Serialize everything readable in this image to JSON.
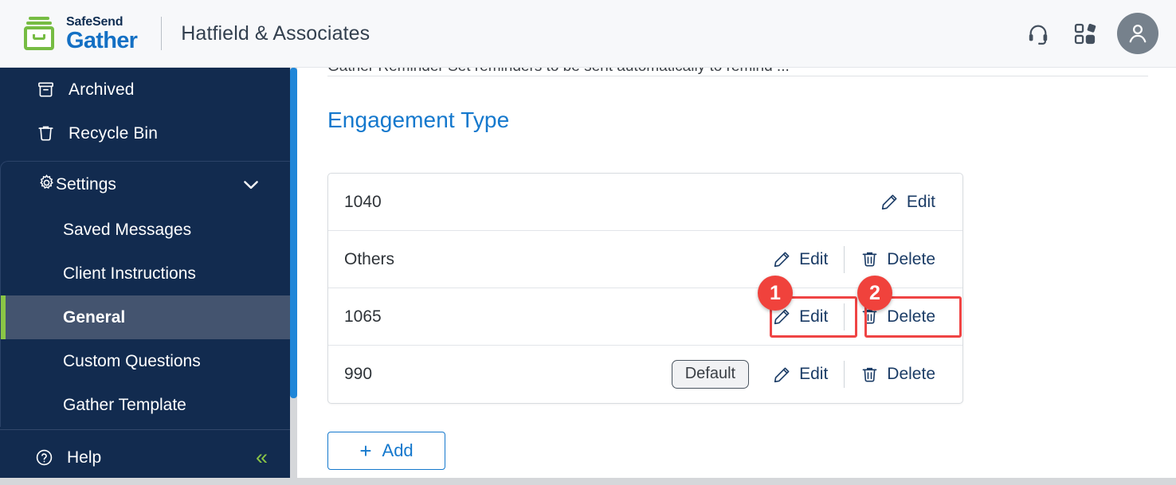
{
  "header": {
    "logo": {
      "icon": "safesend-box-icon",
      "line1": "SafeSend",
      "line2": "Gather"
    },
    "firm_name": "Hatfield & Associates",
    "support_icon": "headset-icon",
    "apps_icon": "apps-grid-icon",
    "avatar_icon": "user-avatar-icon"
  },
  "sidebar": {
    "items": [
      {
        "label": "Archived",
        "icon": "archive-box-icon"
      },
      {
        "label": "Recycle Bin",
        "icon": "trash-icon"
      }
    ],
    "settings": {
      "label": "Settings",
      "icon": "gear-icon",
      "chevron": "chevron-down-icon",
      "subitems": [
        {
          "label": "Saved Messages",
          "active": false
        },
        {
          "label": "Client Instructions",
          "active": false
        },
        {
          "label": "General",
          "active": true
        },
        {
          "label": "Custom Questions",
          "active": false
        },
        {
          "label": "Gather Template",
          "active": false
        }
      ]
    },
    "help": {
      "label": "Help",
      "icon": "question-circle-icon",
      "collapse_icon": "chevron-double-left-icon",
      "collapse_glyph": "«"
    }
  },
  "main": {
    "clipped_text": "Gather Reminder                    Set reminders to be sent automatically to remind ...",
    "section_title": "Engagement Type",
    "table": {
      "rows": [
        {
          "name": "1040",
          "default_badge": null,
          "actions": [
            {
              "label": "Edit",
              "icon": "pencil-icon"
            }
          ]
        },
        {
          "name": "Others",
          "default_badge": null,
          "actions": [
            {
              "label": "Edit",
              "icon": "pencil-icon"
            },
            {
              "label": "Delete",
              "icon": "trash-icon"
            }
          ]
        },
        {
          "name": "1065",
          "default_badge": null,
          "actions": [
            {
              "label": "Edit",
              "icon": "pencil-icon"
            },
            {
              "label": "Delete",
              "icon": "trash-icon"
            }
          ]
        },
        {
          "name": "990",
          "default_badge": "Default",
          "actions": [
            {
              "label": "Edit",
              "icon": "pencil-icon"
            },
            {
              "label": "Delete",
              "icon": "trash-icon"
            }
          ]
        }
      ]
    },
    "add_button": {
      "plus": "+",
      "label": "Add"
    }
  },
  "annotations": [
    {
      "number": "1",
      "target": "edit-action-row-1065"
    },
    {
      "number": "2",
      "target": "delete-action-row-1065"
    }
  ],
  "colors": {
    "brand_green": "#76bc43",
    "brand_blue": "#1470c4",
    "sidebar_bg": "#122b4f",
    "sidebar_active": "#44546f",
    "accent_green": "#8ac546",
    "link_blue": "#1478cd",
    "action_navy": "#1b3c66",
    "annotation_red": "#f0423c",
    "scrollbar_blue": "#1f86d8"
  }
}
